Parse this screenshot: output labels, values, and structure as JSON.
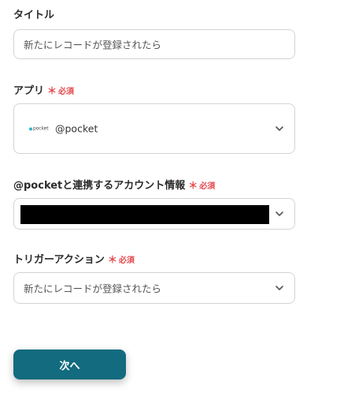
{
  "title_field": {
    "label": "タイトル",
    "value": "新たにレコードが登録されたら"
  },
  "app_field": {
    "label": "アプリ",
    "required": "必須",
    "logo_text": "pocket",
    "value": "@pocket"
  },
  "account_field": {
    "label": "@pocketと連携するアカウント情報",
    "required": "必須"
  },
  "trigger_field": {
    "label": "トリガーアクション",
    "required": "必須",
    "value": "新たにレコードが登録されたら"
  },
  "next_button": {
    "label": "次へ"
  },
  "colors": {
    "primary_button": "#136b7f",
    "required": "#e5484d",
    "border": "#d4d4d4"
  },
  "icons": {
    "dropdown": "chevron-down-icon",
    "required_marker": "asterisk-icon",
    "app_logo": "pocket-logo-icon"
  }
}
